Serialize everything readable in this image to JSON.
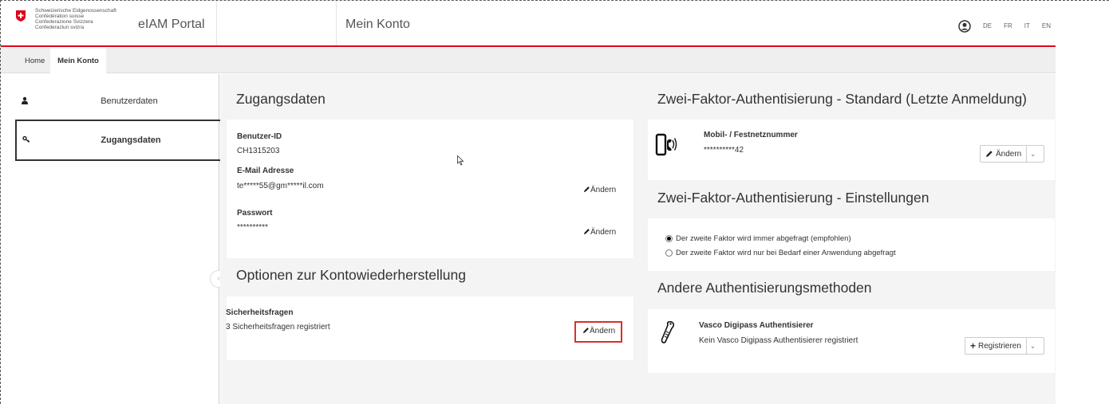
{
  "header": {
    "confederation": [
      "Schweizerische Eidgenossenschaft",
      "Confédération suisse",
      "Confederazione Svizzera",
      "Confederaziun svizra"
    ],
    "app_title": "eIAM Portal",
    "page_title": "Mein Konto",
    "languages": [
      "DE",
      "FR",
      "IT",
      "EN"
    ],
    "brand_color": "#dc0018"
  },
  "breadcrumb": {
    "home": "Home",
    "current": "Mein Konto"
  },
  "sidebar": {
    "items": [
      {
        "label": "Benutzerdaten",
        "icon": "user-icon"
      },
      {
        "label": "Zugangsdaten",
        "icon": "key-icon",
        "active": true
      }
    ]
  },
  "zugangsdaten": {
    "title": "Zugangsdaten",
    "user_id_label": "Benutzer-ID",
    "user_id_value": "CH1315203",
    "email_label": "E-Mail Adresse",
    "email_value": "te*****55@gm*****il.com",
    "email_edit": "Ändern",
    "password_label": "Passwort",
    "password_value": "**********",
    "password_edit": "Ändern"
  },
  "recovery": {
    "title": "Optionen zur Kontowiederherstellung",
    "questions_label": "Sicherheitsfragen",
    "questions_value": "3 Sicherheitsfragen registriert",
    "questions_edit": "Ändern"
  },
  "twofa_standard": {
    "title": "Zwei-Faktor-Authentisierung - Standard (Letzte Anmeldung)",
    "method_label": "Mobil- / Festnetznummer",
    "method_value": "**********42",
    "button": "Ändern"
  },
  "twofa_settings": {
    "title": "Zwei-Faktor-Authentisierung - Einstellungen",
    "option_always": "Der zweite Faktor wird immer abgefragt (empfohlen)",
    "option_on_demand": "Der zweite Faktor wird nur bei Bedarf einer Anwendung abgefragt",
    "selected": "always"
  },
  "other_methods": {
    "title": "Andere Authentisierungsmethoden",
    "method_label": "Vasco Digipass Authentisierer",
    "method_value": "Kein Vasco Digipass Authentisierer registriert",
    "button": "Registrieren"
  }
}
